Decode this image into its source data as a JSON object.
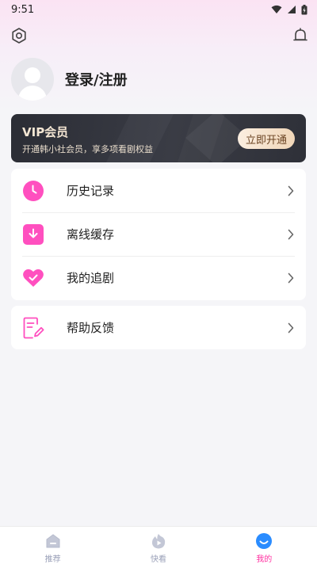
{
  "status_bar": {
    "time": "9:51"
  },
  "profile": {
    "login_label": "登录/注册"
  },
  "vip": {
    "title": "VIP会员",
    "description": "开通韩小社会员，享多项看剧权益",
    "button_label": "立即开通"
  },
  "menu": {
    "items": [
      {
        "label": "历史记录",
        "icon": "clock-icon"
      },
      {
        "label": "离线缓存",
        "icon": "download-icon"
      },
      {
        "label": "我的追剧",
        "icon": "heart-check-icon"
      }
    ],
    "help": {
      "label": "帮助反馈",
      "icon": "feedback-edit-icon"
    }
  },
  "bottom_nav": {
    "items": [
      {
        "label": "推荐",
        "icon": "home-icon",
        "active": false
      },
      {
        "label": "快看",
        "icon": "play-flame-icon",
        "active": false
      },
      {
        "label": "我的",
        "icon": "smile-icon",
        "active": true
      }
    ]
  },
  "colors": {
    "accent": "#ff4fbf",
    "vip_dark": "#2f3139",
    "vip_gold": "#f4e6d3",
    "nav_active": "#ff2fa0"
  }
}
